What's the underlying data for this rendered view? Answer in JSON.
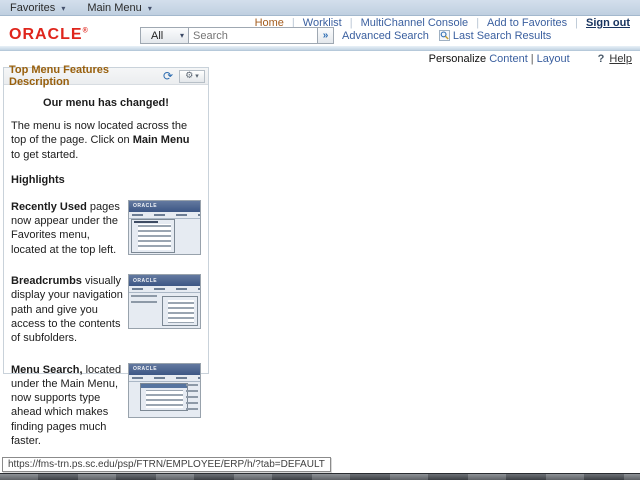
{
  "menubar": {
    "favorites": "Favorites",
    "main_menu": "Main Menu",
    "caret": "▾"
  },
  "header": {
    "logo_text": "ORACLE",
    "nav_links": {
      "home": "Home",
      "worklist": "Worklist",
      "multichannel_console": "MultiChannel Console",
      "add_to_favorites": "Add to Favorites",
      "sign_out": "Sign out",
      "separator": "|"
    },
    "search": {
      "scope": "All",
      "caret": "▾",
      "placeholder": "Search",
      "value": "",
      "go": "»",
      "advanced_search": "Advanced Search",
      "last_search_results": "Last Search Results"
    }
  },
  "personalize_bar": {
    "personalize": "Personalize",
    "content_link": "Content",
    "separator": "|",
    "layout_link": "Layout",
    "help_icon": "?",
    "help": "Help"
  },
  "pagelet": {
    "title": "Top Menu Features Description",
    "refresh_glyph": "⟳",
    "gear_glyph": "⚙",
    "gear_caret": "▾",
    "announcement": "Our menu has changed!",
    "intro": {
      "text_before": "The menu is now located across the top of the page. Click on ",
      "bold": "Main Menu",
      "text_after": " to get started."
    },
    "highlights_heading": "Highlights",
    "sections": [
      {
        "lead": "Recently Used",
        "rest": " pages now appear under the Favorites menu, located at the top left."
      },
      {
        "lead": "Breadcrumbs",
        "rest": " visually display your navigation path and give you access to the contents of subfolders."
      },
      {
        "lead": "Menu Search,",
        "rest": " located under the Main Menu, now supports type ahead which makes finding pages much faster."
      }
    ],
    "thumbnail_logo": "ORACLE"
  },
  "status_tooltip": {
    "url": "https://fms-trn.ps.sc.edu/psp/FTRN/EMPLOYEE/ERP/h/?tab=DEFAULT"
  },
  "colors": {
    "oracle_red": "#df251c",
    "link_blue": "#3a5f9f",
    "home_orange": "#a35c1e",
    "pagelet_title_brown": "#99600d",
    "topbar_blue": "#c7d5e5"
  }
}
